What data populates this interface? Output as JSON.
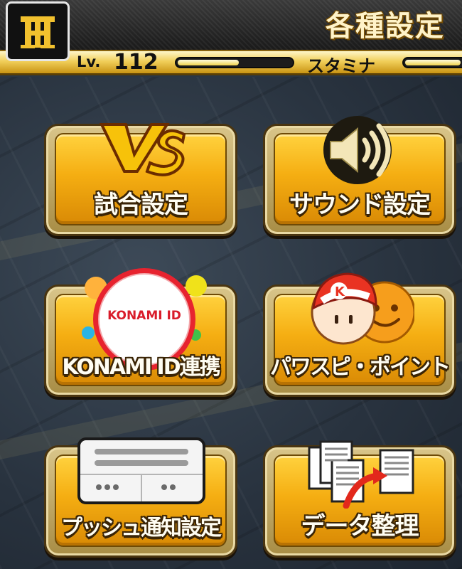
{
  "header": {
    "title": "各種設定",
    "level_prefix": "Lv.",
    "level_value": "112",
    "stamina_label": "スタミナ",
    "exp_progress": 0.55,
    "stamina_progress": 0.85,
    "team_logo_letters": "TH"
  },
  "menu": {
    "match_settings": {
      "label": "試合設定",
      "icon": "vs-icon",
      "icon_text": "VS"
    },
    "sound_settings": {
      "label": "サウンド設定",
      "icon": "speaker-icon"
    },
    "konami_id": {
      "label": "KONAMI ID連携",
      "icon": "konami-id-badge-icon",
      "badge_text": "KONAMI ID"
    },
    "pawa_points": {
      "label": "パワスピ・ポイント",
      "icon": "pawa-mascot-icon",
      "cap_letter": "K"
    },
    "push_settings": {
      "label": "プッシュ通知設定",
      "icon": "notification-device-icon"
    },
    "data_cleanup": {
      "label": "データ整理",
      "icon": "documents-transfer-icon"
    }
  },
  "colors": {
    "tile_gold": "#f5ae12",
    "header_gold": "#f1cf5a",
    "konami_red": "#e7232f",
    "background": "#2a3644"
  }
}
